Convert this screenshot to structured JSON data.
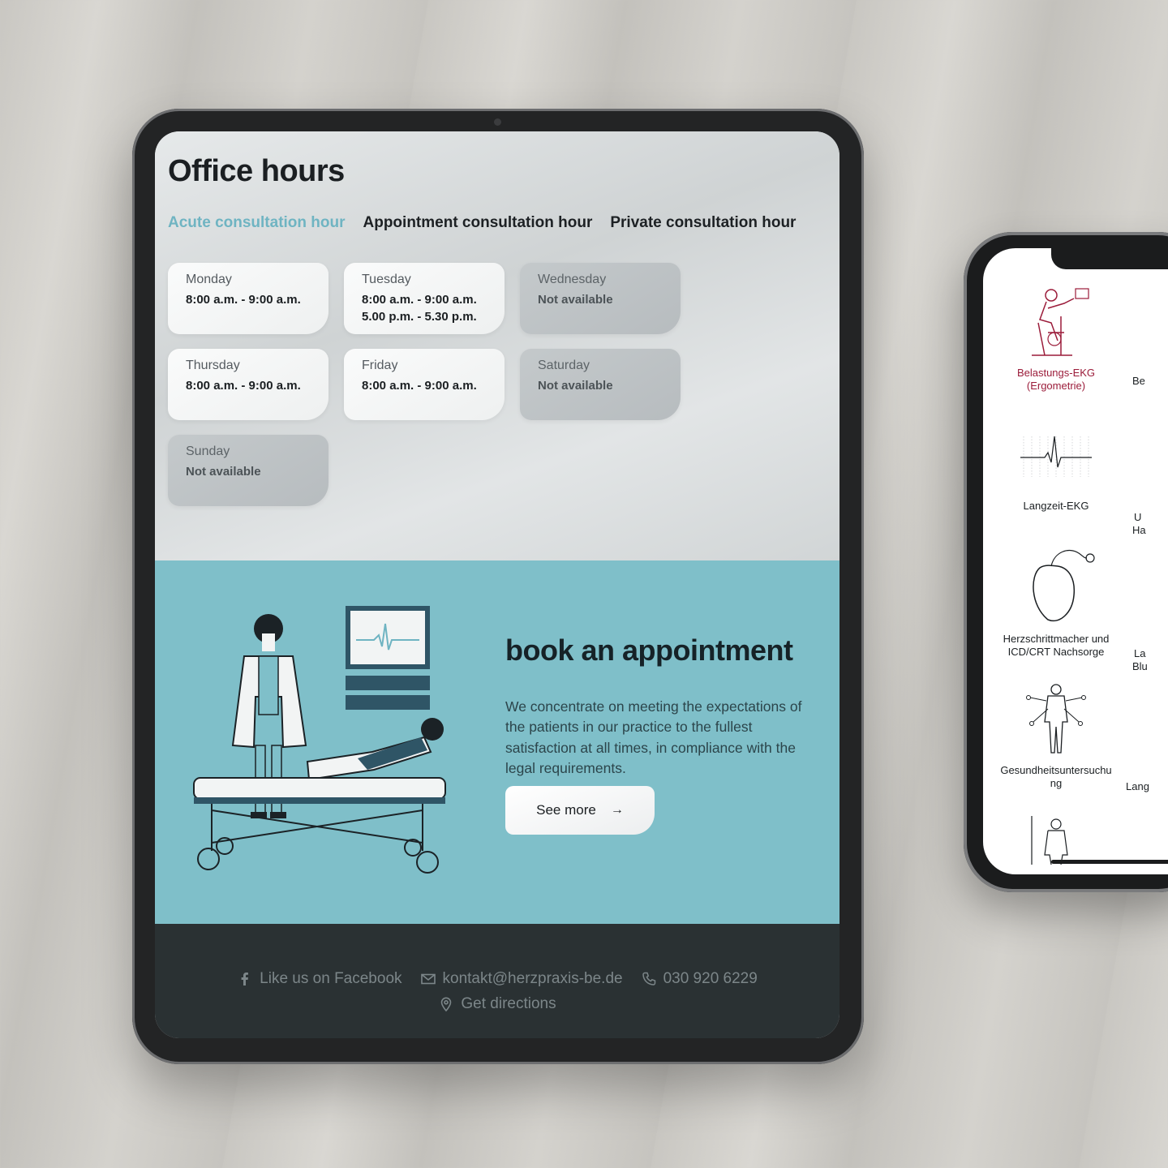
{
  "office_hours": {
    "title": "Office hours",
    "tabs": [
      {
        "label": "Acute consultation hour",
        "active": true
      },
      {
        "label": "Appointment consultation hour",
        "active": false
      },
      {
        "label": "Private consultation hour",
        "active": false
      }
    ],
    "days": [
      {
        "day": "Monday",
        "line1": "8:00 a.m. - 9:00 a.m.",
        "line2": "",
        "available": true
      },
      {
        "day": "Tuesday",
        "line1": "8:00 a.m. - 9:00 a.m.",
        "line2": "5.00 p.m. - 5.30 p.m.",
        "available": true
      },
      {
        "day": "Wednesday",
        "line1": "Not available",
        "line2": "",
        "available": false
      },
      {
        "day": "Thursday",
        "line1": "8:00 a.m. - 9:00 a.m.",
        "line2": "",
        "available": true
      },
      {
        "day": "Friday",
        "line1": "8:00 a.m. - 9:00 a.m.",
        "line2": "",
        "available": true
      },
      {
        "day": "Saturday",
        "line1": "Not available",
        "line2": "",
        "available": false
      },
      {
        "day": "Sunday",
        "line1": "Not available",
        "line2": "",
        "available": false
      }
    ]
  },
  "booking": {
    "title": "book an appointment",
    "text": "We concentrate on meeting the expectations of the patients in our practice to the fullest satisfaction at all times, in compliance with the legal requirements.",
    "button_label": "See more",
    "button_icon": "arrow-right-icon"
  },
  "footer": {
    "facebook": "Like us on Facebook",
    "email": "kontakt@herzpraxis-be.de",
    "phone": "030 920 6229",
    "directions": "Get directions"
  },
  "phone_services": [
    {
      "label": "Belastungs-EKG (Ergometrie)",
      "icon": "ergometer-icon",
      "active": true
    },
    {
      "label": "Langzeit-EKG",
      "icon": "ecg-icon",
      "active": false
    },
    {
      "label": "Herzschrittmacher und ICD/CRT Nachsorge",
      "icon": "pacemaker-icon",
      "active": false
    },
    {
      "label": "Gesundheitsuntersuchu ng",
      "icon": "body-checkup-icon",
      "active": false
    }
  ],
  "phone_partial_labels": [
    "Be",
    "U",
    "Ha",
    "La",
    "Blu",
    "Lang"
  ],
  "colors": {
    "accent": "#6fb4c2",
    "booking_bg": "#7fbfc9",
    "footer_bg": "#2a3133",
    "active_service": "#9b1c3a"
  }
}
